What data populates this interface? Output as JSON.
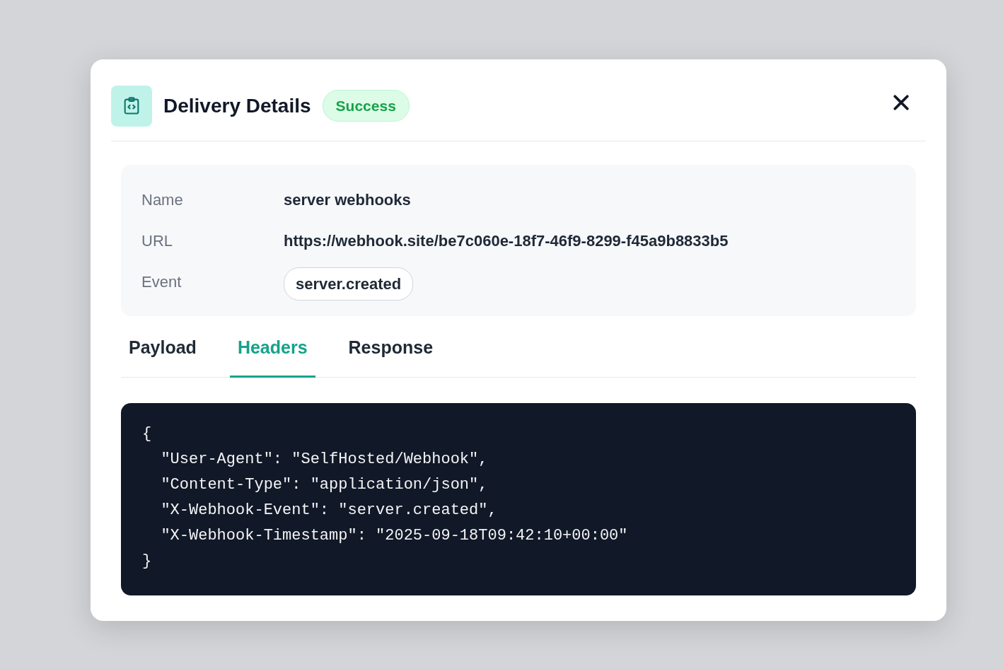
{
  "dialog": {
    "title": "Delivery Details",
    "status": {
      "label": "Success",
      "kind": "success"
    }
  },
  "details": [
    {
      "label": "Name",
      "value": "server webhooks",
      "kind": "text"
    },
    {
      "label": "URL",
      "value": "https://webhook.site/be7c060e-18f7-46f9-8299-f45a9b8833b5",
      "kind": "text"
    },
    {
      "label": "Event",
      "value": "server.created",
      "kind": "tag"
    }
  ],
  "tabs": [
    {
      "label": "Payload",
      "selected": false
    },
    {
      "label": "Headers",
      "selected": true
    },
    {
      "label": "Response",
      "selected": false
    }
  ],
  "code": [
    "{",
    "  \"User-Agent\": \"SelfHosted/Webhook\",",
    "  \"Content-Type\": \"application/json\",",
    "  \"X-Webhook-Event\": \"server.created\",",
    "  \"X-Webhook-Timestamp\": \"2025-09-18T09:42:10+00:00\"",
    "}"
  ]
}
